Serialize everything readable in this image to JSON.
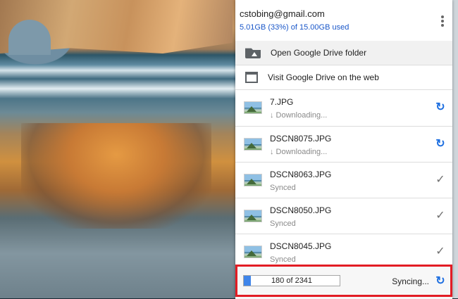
{
  "account": {
    "email": "cstobing@gmail.com",
    "usage": "5.01GB (33%) of 15.00GB used"
  },
  "menu": [
    {
      "label": "Open Google Drive folder",
      "icon": "drive-folder-icon"
    },
    {
      "label": "Visit Google Drive on the web",
      "icon": "browser-window-icon"
    }
  ],
  "files": [
    {
      "name": "7.JPG",
      "status": "↓ Downloading...",
      "state_icon": "sync-icon"
    },
    {
      "name": "DSCN8075.JPG",
      "status": "↓ Downloading...",
      "state_icon": "sync-icon"
    },
    {
      "name": "DSCN8063.JPG",
      "status": "Synced",
      "state_icon": "check-icon"
    },
    {
      "name": "DSCN8050.JPG",
      "status": "Synced",
      "state_icon": "check-icon"
    },
    {
      "name": "DSCN8045.JPG",
      "status": "Synced",
      "state_icon": "check-icon"
    }
  ],
  "footer": {
    "progress_text": "180 of 2341",
    "progress_done": 180,
    "progress_total": 2341,
    "status": "Syncing..."
  },
  "colors": {
    "accent": "#1e6fe0",
    "highlight": "#e21c24",
    "progress": "#3f85ea"
  }
}
